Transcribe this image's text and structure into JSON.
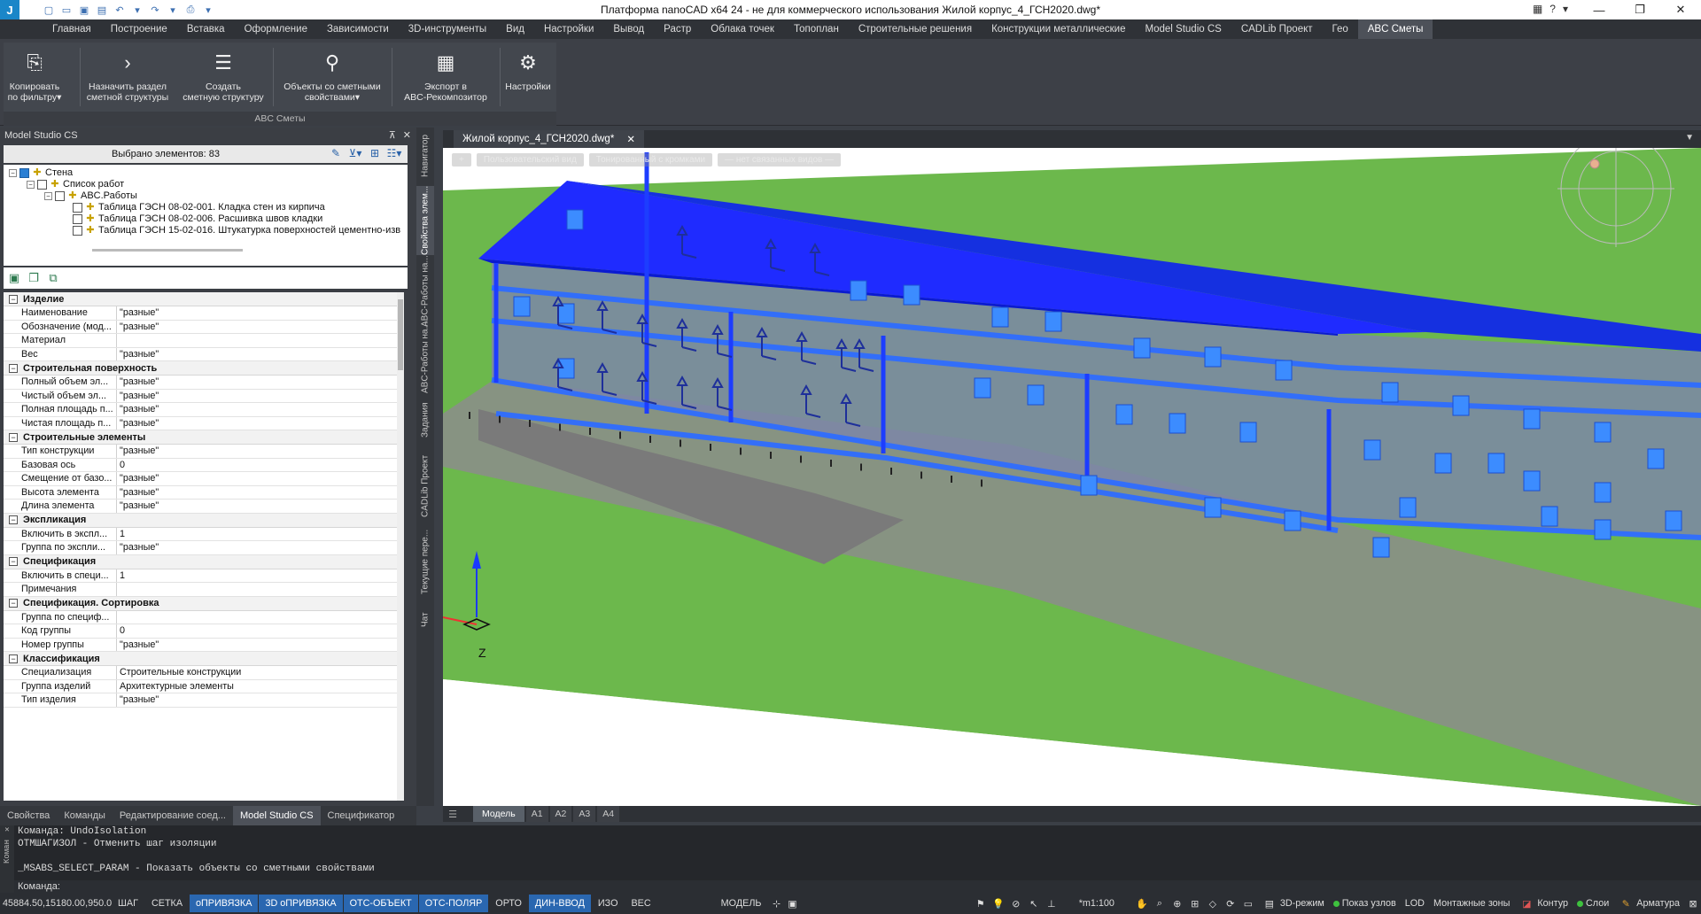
{
  "window": {
    "title": "Платформа nanoCAD x64 24 - не для коммерческого использования Жилой корпус_4_ГСН2020.dwg*",
    "logo": "J",
    "help_label": "?"
  },
  "ribbon_tabs": [
    "Главная",
    "Построение",
    "Вставка",
    "Оформление",
    "Зависимости",
    "3D-инструменты",
    "Вид",
    "Настройки",
    "Вывод",
    "Растр",
    "Облака точек",
    "Топоплан",
    "Строительные решения",
    "Конструкции металлические",
    "Model Studio CS",
    "CADLib Проект",
    "Гео",
    "ABC Сметы"
  ],
  "active_ribbon_tab": "ABC Сметы",
  "ribbon": {
    "group_label": "ABC Сметы",
    "buttons": [
      {
        "line1": "Копировать",
        "line2": "по фильтру▾",
        "icon": "copy-filter-icon"
      },
      {
        "line1": "Назначить раздел",
        "line2": "сметной структуры",
        "icon": "assign-section-icon"
      },
      {
        "line1": "Создать",
        "line2": "сметную структуру",
        "icon": "create-structure-icon"
      },
      {
        "line1": "Объекты со сметными",
        "line2": "свойствами▾",
        "icon": "objects-properties-icon"
      },
      {
        "line1": "Экспорт в",
        "line2": "ABC-Рекомпозитор",
        "icon": "export-icon"
      },
      {
        "line1": "Настройки",
        "line2": "",
        "icon": "settings-gear-icon"
      }
    ]
  },
  "left_panel": {
    "title": "Model Studio CS",
    "selected_count_label": "Выбрано элементов: 83",
    "tree": [
      {
        "label": "Стена",
        "level": 0,
        "checked": true,
        "expanded": true
      },
      {
        "label": "Список работ",
        "level": 1,
        "checked": false,
        "expanded": true
      },
      {
        "label": "ABC.Работы",
        "level": 2,
        "checked": false,
        "expanded": true
      },
      {
        "label": "Таблица ГЭСН 08-02-001. Кладка стен из кирпича",
        "level": 3,
        "checked": false
      },
      {
        "label": "Таблица ГЭСН 08-02-006. Расшивка швов кладки",
        "level": 3,
        "checked": false
      },
      {
        "label": "Таблица ГЭСН 15-02-016. Штукатурка поверхностей цементно-изв",
        "level": 3,
        "checked": false
      }
    ],
    "properties": [
      {
        "section": "Изделие",
        "rows": [
          {
            "name": "Наименование",
            "value": "\"разные\""
          },
          {
            "name": "Обозначение (мод...",
            "value": "\"разные\""
          },
          {
            "name": "Материал",
            "value": ""
          },
          {
            "name": "Вес",
            "value": "\"разные\""
          }
        ]
      },
      {
        "section": "Строительная поверхность",
        "rows": [
          {
            "name": "Полный объем эл...",
            "value": "\"разные\""
          },
          {
            "name": "Чистый объем эл...",
            "value": "\"разные\""
          },
          {
            "name": "Полная площадь п...",
            "value": "\"разные\""
          },
          {
            "name": "Чистая площадь п...",
            "value": "\"разные\""
          }
        ]
      },
      {
        "section": "Строительные элементы",
        "rows": [
          {
            "name": "Тип конструкции",
            "value": "\"разные\""
          },
          {
            "name": "Базовая ось",
            "value": "0"
          },
          {
            "name": "Смещение от базо...",
            "value": "\"разные\""
          },
          {
            "name": "Высота элемента",
            "value": "\"разные\""
          },
          {
            "name": "Длина элемента",
            "value": "\"разные\""
          }
        ]
      },
      {
        "section": "Экспликация",
        "rows": [
          {
            "name": "Включить в экспл...",
            "value": "1"
          },
          {
            "name": "Группа по экспли...",
            "value": "\"разные\""
          }
        ]
      },
      {
        "section": "Спецификация",
        "rows": [
          {
            "name": "Включить в специ...",
            "value": "1"
          },
          {
            "name": "Примечания",
            "value": ""
          }
        ]
      },
      {
        "section": "Спецификация. Сортировка",
        "rows": [
          {
            "name": "Группа по специф...",
            "value": ""
          },
          {
            "name": "Код группы",
            "value": "0"
          },
          {
            "name": "Номер группы",
            "value": "\"разные\""
          }
        ]
      },
      {
        "section": "Классификация",
        "rows": [
          {
            "name": "Специализация",
            "value": "Строительные конструкции"
          },
          {
            "name": "Группа изделий",
            "value": "Архитектурные элементы"
          },
          {
            "name": "Тип изделия",
            "value": "\"разные\""
          }
        ]
      }
    ],
    "side_tabs": [
      "Навигатор",
      "Свойства элем...",
      "ABC-Работы на...",
      "ABC-Работы на...",
      "Задания",
      "CADLib Проект",
      "Текущие пере...",
      "Чат"
    ],
    "active_side_tab": "Свойства элем...",
    "bottom_tabs": [
      "Свойства",
      "Команды",
      "Редактирование соед...",
      "Model Studio CS",
      "Спецификатор"
    ],
    "active_bottom_tab": "Model Studio CS"
  },
  "document": {
    "tab_label": "Жилой корпус_4_ГСН2020.dwg*",
    "view_controls": [
      "+",
      "Пользовательский вид",
      "Тонированный с кромками",
      "— нет связанных видов —"
    ],
    "axis_label": "Z"
  },
  "model_tabs": [
    "Модель",
    "A1",
    "A2",
    "A3",
    "A4"
  ],
  "active_model_tab": "Модель",
  "command_line": {
    "history": [
      "Команда: UndoIsolation",
      "ОТМШАГИЗОЛ - Отменить шаг изоляции",
      "",
      "_MSABS_SELECT_PARAM - Показать объекты со сметными свойствами"
    ],
    "prompt": "Команда:",
    "side_label": "Коман"
  },
  "status_bar": {
    "coords": "45884.50,15180.00,950.0",
    "toggles": [
      {
        "label": "ШАГ",
        "on": false
      },
      {
        "label": "СЕТКА",
        "on": false
      },
      {
        "label": "оПРИВЯЗКА",
        "on": true
      },
      {
        "label": "3D оПРИВЯЗКА",
        "on": true
      },
      {
        "label": "ОТС-ОБЪЕКТ",
        "on": true
      },
      {
        "label": "ОТС-ПОЛЯР",
        "on": true
      },
      {
        "label": "ОРТО",
        "on": false
      },
      {
        "label": "ДИН-ВВОД",
        "on": true
      },
      {
        "label": "ИЗО",
        "on": false
      },
      {
        "label": "ВЕС",
        "on": false
      }
    ],
    "model_label": "МОДЕЛЬ",
    "scale": "*m1:100",
    "mode_3d": "3D-режим",
    "show_nodes": "Показ узлов",
    "lod": "LOD",
    "mount_zones": "Монтажные зоны",
    "contour": "Контур",
    "layers": "Слои",
    "armature": "Арматура"
  },
  "colors": {
    "accent": "#2a67b0",
    "ground": "#6cb84c",
    "building": "#1f4fff",
    "dark_bg": "#3b3f46"
  }
}
